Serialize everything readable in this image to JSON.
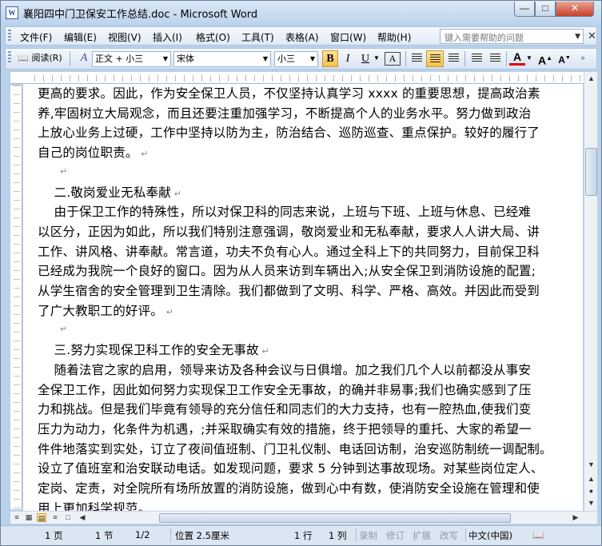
{
  "window": {
    "title": "襄阳四中门卫保安工作总结.doc - Microsoft Word",
    "icon_label": "W"
  },
  "menu": {
    "items": [
      "文件(F)",
      "编辑(E)",
      "视图(V)",
      "插入(I)",
      "格式(O)",
      "工具(T)",
      "表格(A)",
      "窗口(W)",
      "帮助(H)"
    ],
    "help_placeholder": "键入需要帮助的问题"
  },
  "toolbar": {
    "read_label": "阅读(R)",
    "style_value": "正文 + 小三",
    "font_value": "宋体",
    "size_value": "小三",
    "bold": "B",
    "italic": "I",
    "underline": "U",
    "charborder": "A",
    "fontcolor": "A",
    "grow": "A",
    "shrink": "A"
  },
  "document": {
    "lines": [
      "更高的要求。因此，作为安全保卫人员，不仅坚持认真学习 xxxx 的重要思想，提高政治素",
      "养,牢固树立大局观念，而且还要注重加强学习，不断提高个人的业务水平。努力做到政治",
      "上放心业务上过硬，工作中坚持以防为主，防治结合、巡防巡查、重点保护。较好的履行了",
      "自己的岗位职责。",
      "",
      "    二.敬岗爱业无私奉献",
      "    由于保卫工作的特殊性，所以对保卫科的同志来说，上班与下班、上班与休息、已经难",
      "以区分，正因为如此，所以我们特别注意强调，敬岗爱业和无私奉献，要求人人讲大局、讲",
      "工作、讲风格、讲奉献。常言道，功夫不负有心人。通过全科上下的共同努力，目前保卫科",
      "已经成为我院一个良好的窗口。因为从人员来访到车辆出入;从安全保卫到消防设施的配置;",
      "从学生宿舍的安全管理到卫生清除。我们都做到了文明、科学、严格、高效。并因此而受到",
      "了广大教职工的好评。",
      "",
      "    三.努力实现保卫科工作的安全无事故",
      "    随着法官之家的启用，领导来访及各种会议与日俱增。加之我们几个人以前都没从事安",
      "全保卫工作，因此如何努力实现保卫工作安全无事故，的确并非易事;我们也确实感到了压",
      "力和挑战。但是我们毕竟有领导的充分信任和同志们的大力支持，也有一腔热血,使我们变",
      "压力为动力，化条件为机遇，;并采取确实有效的措施，终于把领导的重托、大家的希望一",
      "件件地落实到实处，订立了夜间值班制、门卫礼仪制、电话回访制，治安巡防制统一调配制。",
      "设立了值班室和治安联动电话。如发现问题，要求 5 分钟到达事故现场。对某些岗位定人、",
      "定岗、定责，对全院所有场所放置的消防设施，做到心中有数，使消防安全设施在管理和使",
      "用上更加科学规范。"
    ],
    "para_marks": [
      3,
      4,
      5,
      11,
      12,
      13
    ]
  },
  "status": {
    "page": "1 页",
    "section": "1 节",
    "pages": "1/2",
    "position": "位置 2.5厘米",
    "line": "1 行",
    "column": "1 列",
    "rec": "录制",
    "trk": "修订",
    "ext": "扩展",
    "ovr": "改写",
    "language": "中文(中国)"
  },
  "colors": {
    "accent": "#f6c04b",
    "titlebar": "#bcd2ec",
    "close": "#c7402b"
  }
}
